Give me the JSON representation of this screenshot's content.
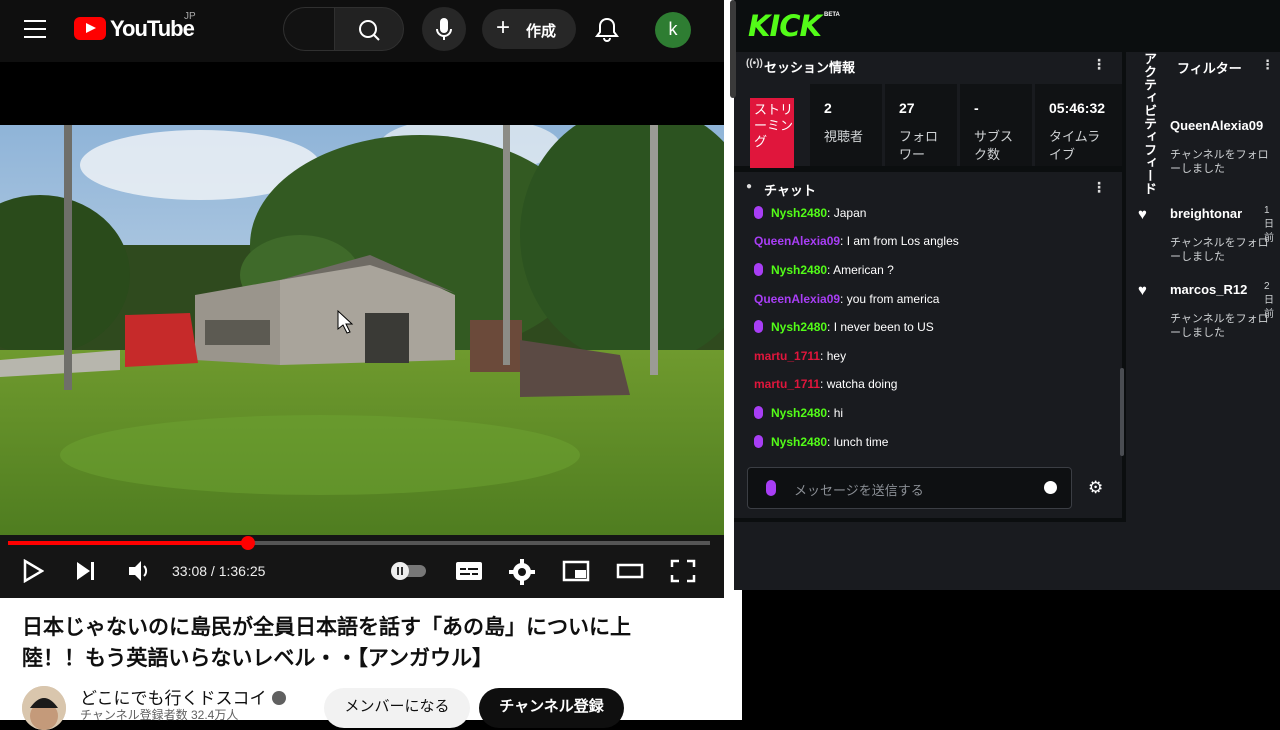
{
  "youtube": {
    "logo_text": "YouTube",
    "region": "JP",
    "create_label": "作成",
    "avatar_letter": "k",
    "player": {
      "current_time": "33:08",
      "duration": "1:36:25",
      "time_display": "33:08 / 1:36:25",
      "progress": 0.342
    },
    "video_title": "日本じゃないのに島民が全員日本語を話す「あの島」についに上陸！！もう英語いらないレベル・・【アンガウル】",
    "channel_name": "どこにでも行くドスコイ",
    "subscribers": "チャンネル登録者数 32.4万人",
    "member_button": "メンバーになる",
    "subscribe_button": "チャンネル登録"
  },
  "kick": {
    "logo": "KICK",
    "beta": "BETA",
    "session": {
      "title": "セッション情報",
      "live_badge": "ストリーミング",
      "stats": [
        {
          "value": "2",
          "label": "視聴者"
        },
        {
          "value": "27",
          "label": "フォロワー"
        },
        {
          "value": "-",
          "label": "サブスク数"
        },
        {
          "value": "05:46:32",
          "label": "タイムライブ"
        }
      ]
    },
    "chat": {
      "title": "チャット",
      "messages": [
        {
          "user": "Nysh2480",
          "text": "Japan",
          "color": "#53fc18",
          "mic": true
        },
        {
          "user": "QueenAlexia09",
          "text": "I am from Los angles",
          "color": "#a83ef5",
          "mic": false
        },
        {
          "user": "Nysh2480",
          "text": "American ?",
          "color": "#53fc18",
          "mic": true
        },
        {
          "user": "QueenAlexia09",
          "text": "you from america",
          "color": "#a83ef5",
          "mic": false
        },
        {
          "user": "Nysh2480",
          "text": "I never been to US",
          "color": "#53fc18",
          "mic": true
        },
        {
          "user": "martu_1711",
          "text": "hey",
          "color": "#e0163c",
          "mic": false
        },
        {
          "user": "martu_1711",
          "text": "watcha doing",
          "color": "#e0163c",
          "mic": false
        },
        {
          "user": "Nysh2480",
          "text": "hi",
          "color": "#53fc18",
          "mic": true
        },
        {
          "user": "Nysh2480",
          "text": "lunch time",
          "color": "#53fc18",
          "mic": true
        }
      ],
      "placeholder": "メッセージを送信する"
    },
    "feed": {
      "vertical_title": "アクティビティフィード",
      "filter_label": "フィルター",
      "items": [
        {
          "user": "QueenAlexia09",
          "time": "",
          "desc": "チャンネルをフォローしました"
        },
        {
          "user": "breightonar",
          "time": "1日前",
          "desc": "チャンネルをフォローしました"
        },
        {
          "user": "marcos_R12",
          "time": "2日前",
          "desc": "チャンネルをフォローしました"
        }
      ]
    }
  },
  "colors": {
    "yt_red": "#ff0000",
    "kick_green": "#53fc18",
    "live_red": "#e0163c",
    "mic_purple": "#a83ef5"
  }
}
